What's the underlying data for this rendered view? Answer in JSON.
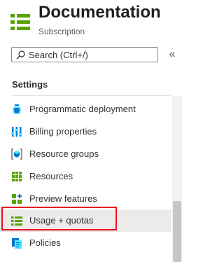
{
  "header": {
    "title": "Documentation",
    "subtitle": "Subscription",
    "icon": "usage-quotas-icon"
  },
  "search": {
    "placeholder": "Search (Ctrl+/)",
    "icon": "search-icon"
  },
  "collapse_glyph": "«",
  "section": {
    "title": "Settings"
  },
  "menu": {
    "items": [
      {
        "label": "Programmatic deployment",
        "icon": "programmatic-deployment-icon"
      },
      {
        "label": "Billing properties",
        "icon": "billing-properties-icon"
      },
      {
        "label": "Resource groups",
        "icon": "resource-groups-icon"
      },
      {
        "label": "Resources",
        "icon": "resources-icon"
      },
      {
        "label": "Preview features",
        "icon": "preview-features-icon"
      },
      {
        "label": "Usage + quotas",
        "icon": "usage-quotas-icon",
        "selected": true
      },
      {
        "label": "Policies",
        "icon": "policies-icon"
      }
    ]
  },
  "colors": {
    "highlight_border": "#e81123",
    "selected_bg": "#edebe9",
    "icon_green": "#57a300",
    "icon_blue": "#0078d4"
  }
}
